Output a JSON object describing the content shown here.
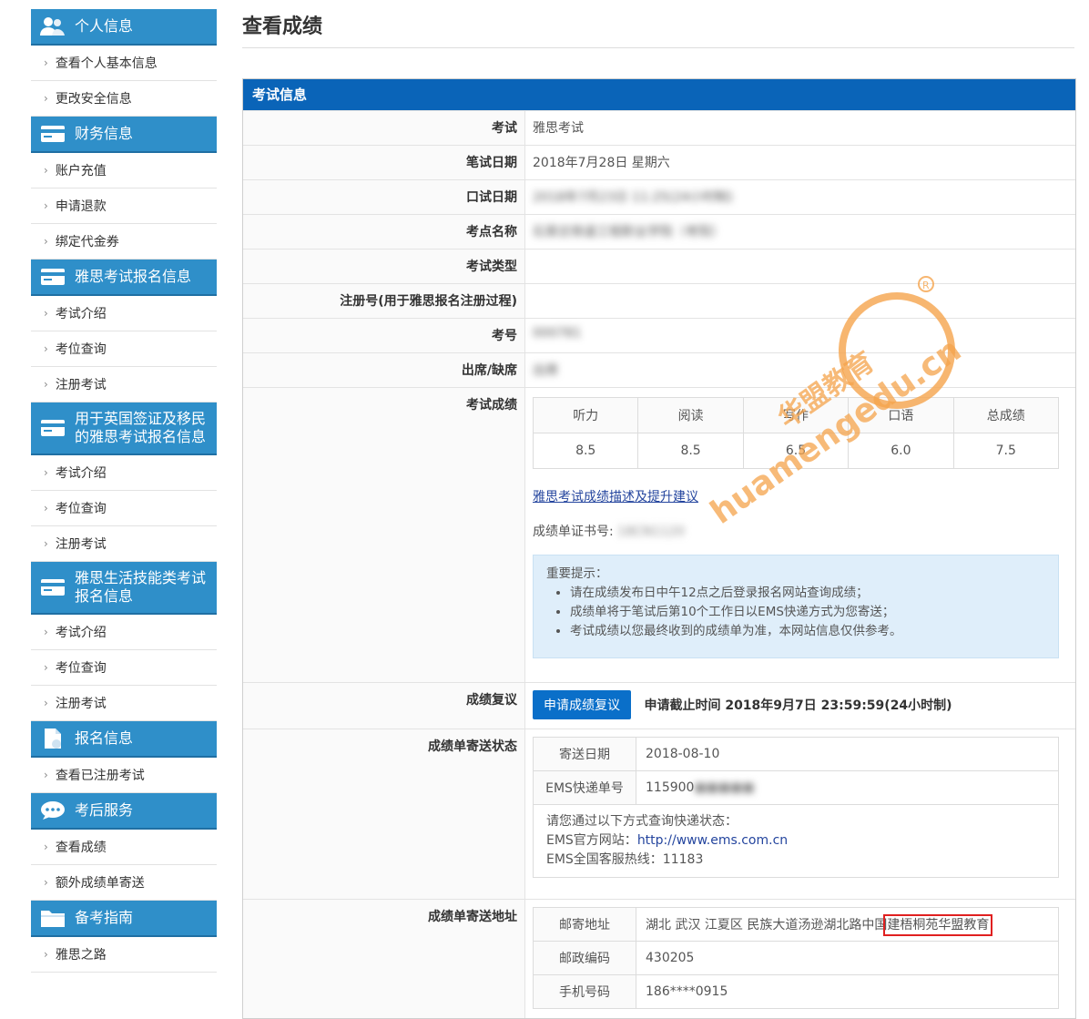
{
  "sidebar": {
    "sections": [
      {
        "title": "个人信息",
        "icon": "users-icon",
        "items": [
          "查看个人基本信息",
          "更改安全信息"
        ]
      },
      {
        "title": "财务信息",
        "icon": "card-icon",
        "items": [
          "账户充值",
          "申请退款",
          "绑定代金券"
        ]
      },
      {
        "title": "雅思考试报名信息",
        "icon": "card-icon",
        "items": [
          "考试介绍",
          "考位查询",
          "注册考试"
        ]
      },
      {
        "title": "用于英国签证及移民的雅思考试报名信息",
        "icon": "card-icon",
        "items": [
          "考试介绍",
          "考位查询",
          "注册考试"
        ]
      },
      {
        "title": "雅思生活技能类考试报名信息",
        "icon": "card-icon",
        "items": [
          "考试介绍",
          "考位查询",
          "注册考试"
        ]
      },
      {
        "title": "报名信息",
        "icon": "document-icon",
        "items": [
          "查看已注册考试"
        ]
      },
      {
        "title": "考后服务",
        "icon": "chat-icon",
        "items": [
          "查看成绩",
          "额外成绩单寄送"
        ]
      },
      {
        "title": "备考指南",
        "icon": "folder-icon",
        "items": [
          "雅思之路"
        ]
      }
    ]
  },
  "main": {
    "title": "查看成绩",
    "panel_title": "考试信息",
    "rows": [
      {
        "label": "考试",
        "value": "雅思考试"
      },
      {
        "label": "笔试日期",
        "value": "2018年7月28日 星期六"
      },
      {
        "label": "口试日期",
        "value": "2018年7月23日 11:25(24小时制)"
      },
      {
        "label": "考点名称",
        "value": "石家庄铁道工程职业学院（考院）"
      },
      {
        "label": "考试类型",
        "value": ""
      },
      {
        "label": "注册号(用于雅思报名注册过程)",
        "value": ""
      },
      {
        "label": "考号",
        "value": "000781"
      },
      {
        "label": "出席/缺席",
        "value": "出席"
      }
    ],
    "score_label": "考试成绩",
    "score_headers": [
      "听力",
      "阅读",
      "写作",
      "口语",
      "总成绩"
    ],
    "score_values": [
      "8.5",
      "8.5",
      "6.5",
      "6.0",
      "7.5"
    ],
    "score_link": "雅思考试成绩描述及提升建议",
    "cert_label": "成绩单证书号:",
    "cert_value": "18CN1120",
    "note_title": "重要提示：",
    "notes": [
      "请在成绩发布日中午12点之后登录报名网站查询成绩；",
      "成绩单将于笔试后第10个工作日以EMS快递方式为您寄送；",
      "考试成绩以您最终收到的成绩单为准，本网站信息仅供参考。"
    ],
    "review_label": "成绩复议",
    "review_button": "申请成绩复议",
    "review_deadline": "申请截止时间 2018年9月7日 23:59:59(24小时制)",
    "delivery_label": "成绩单寄送状态",
    "delivery_rows": [
      {
        "k": "寄送日期",
        "v": "2018-08-10"
      },
      {
        "k": "EMS快递单号",
        "v": "115900"
      }
    ],
    "track_intro": "请您通过以下方式查询快递状态：",
    "track_site_label": "EMS官方网站：",
    "track_site_url": "http://www.ems.com.cn",
    "track_phone": "EMS全国客服热线：11183",
    "address_label": "成绩单寄送地址",
    "address_rows": [
      {
        "k": "邮寄地址",
        "v": "湖北 武汉 江夏区 民族大道汤逊湖北路中国",
        "v2": "建梧桐苑华盟教育"
      },
      {
        "k": "邮政编码",
        "v": "430205"
      },
      {
        "k": "手机号码",
        "v": "186****0915"
      }
    ]
  },
  "watermark": {
    "brand": "华盟教育",
    "domain": "huamengedu.cn",
    "color": "#f5a44c"
  }
}
